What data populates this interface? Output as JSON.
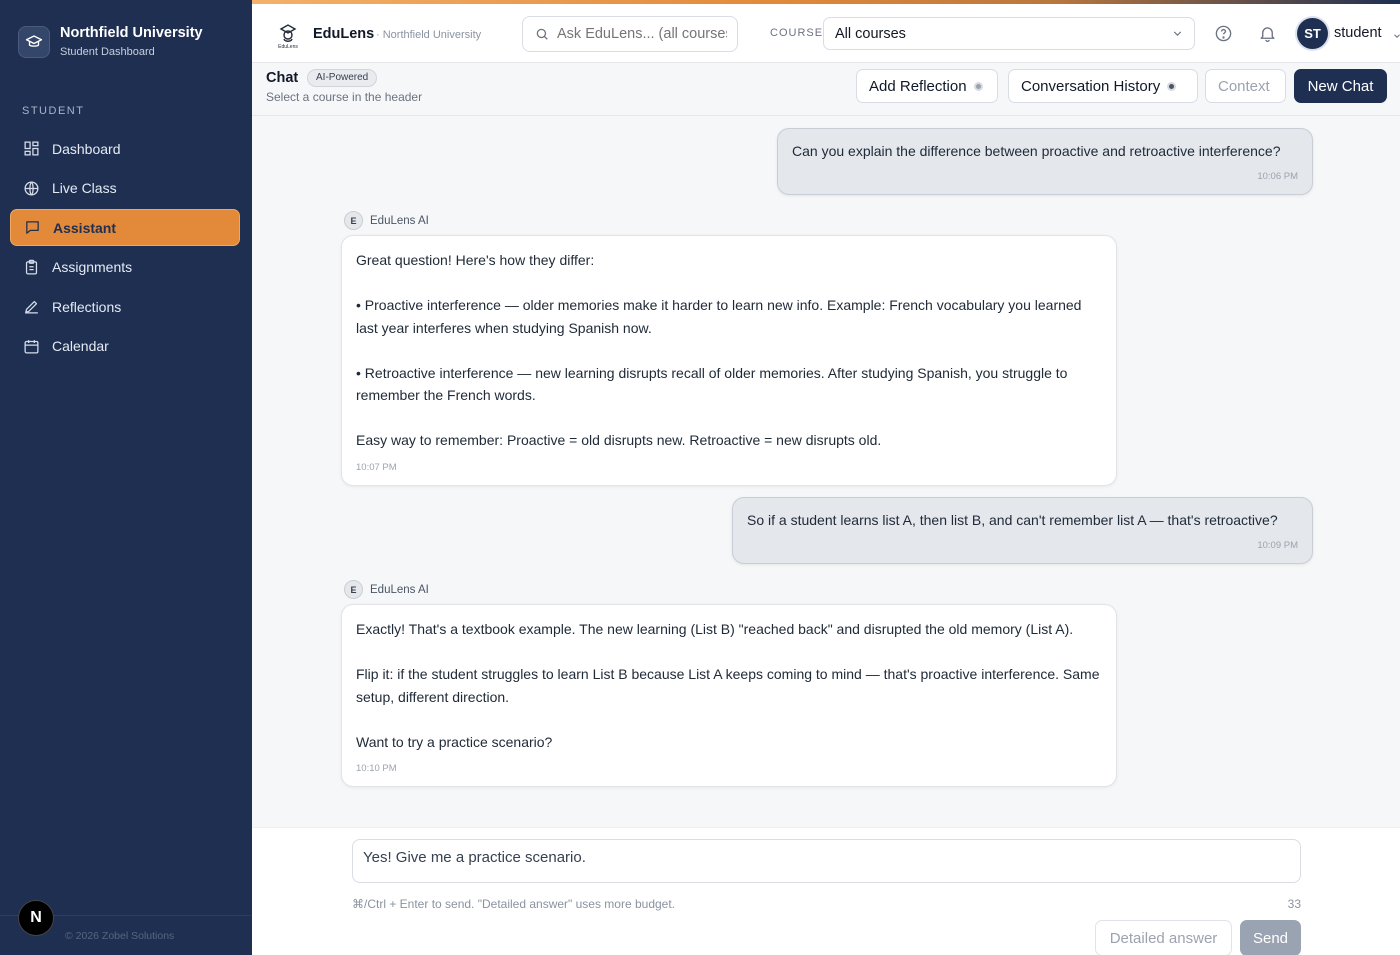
{
  "sidebar": {
    "brand_title": "Northfield University",
    "brand_subtitle": "Student Dashboard",
    "section_label": "STUDENT",
    "items": [
      {
        "label": "Dashboard",
        "icon": "dashboard-icon"
      },
      {
        "label": "Live Class",
        "icon": "live-class-icon"
      },
      {
        "label": "Assistant",
        "icon": "chat-bubble-icon",
        "active": true
      },
      {
        "label": "Assignments",
        "icon": "clipboard-icon"
      },
      {
        "label": "Reflections",
        "icon": "pen-icon"
      },
      {
        "label": "Calendar",
        "icon": "calendar-icon"
      }
    ],
    "copyright": "© 2026 Zobel Solutions",
    "n_badge": "N"
  },
  "header": {
    "app_name": "EduLens",
    "org": "· Northfield University",
    "search_placeholder": "Ask EduLens... (all courses)",
    "course_label": "COURSE",
    "course_value": "All courses",
    "avatar_initials": "ST",
    "username": "student"
  },
  "chat_header": {
    "title": "Chat",
    "badge": "AI-Powered",
    "subtitle": "Select a course in the header",
    "add_reflection": "Add Reflection",
    "conversation_history": "Conversation History",
    "context": "Context",
    "new_chat": "New Chat"
  },
  "messages": {
    "ai_name": "EduLens AI",
    "ai_initial": "E",
    "m1": {
      "text": "Can you explain the difference between proactive and retroactive interference?",
      "time": "10:06 PM"
    },
    "m2": {
      "p1": "Great question! Here's how they differ:",
      "p2": "• Proactive interference — older memories make it harder to learn new info. Example: French vocabulary you learned last year interferes when studying Spanish now.",
      "p3": "• Retroactive interference — new learning disrupts recall of older memories. After studying Spanish, you struggle to remember the French words.",
      "p4": "Easy way to remember: Proactive = old disrupts new. Retroactive = new disrupts old.",
      "time": "10:07 PM"
    },
    "m3": {
      "text": "So if a student learns list A, then list B, and can't remember list A — that's retroactive?",
      "time": "10:09 PM"
    },
    "m4": {
      "p1": "Exactly! That's a textbook example. The new learning (List B) \"reached back\" and disrupted the old memory (List A).",
      "p2": "Flip it: if the student struggles to learn List B because List A keeps coming to mind — that's proactive interference. Same setup, different direction.",
      "p3": "Want to try a practice scenario?",
      "time": "10:10 PM"
    }
  },
  "composer": {
    "value": "Yes! Give me a practice scenario.",
    "hint": "⌘/Ctrl + Enter to send. \"Detailed answer\" uses more budget.",
    "count": "33",
    "detailed_label": "Detailed answer",
    "send_label": "Send"
  },
  "colors": {
    "sidebar_bg": "#1e2f52",
    "accent": "#e28a3a",
    "primary": "#1e2f52"
  }
}
